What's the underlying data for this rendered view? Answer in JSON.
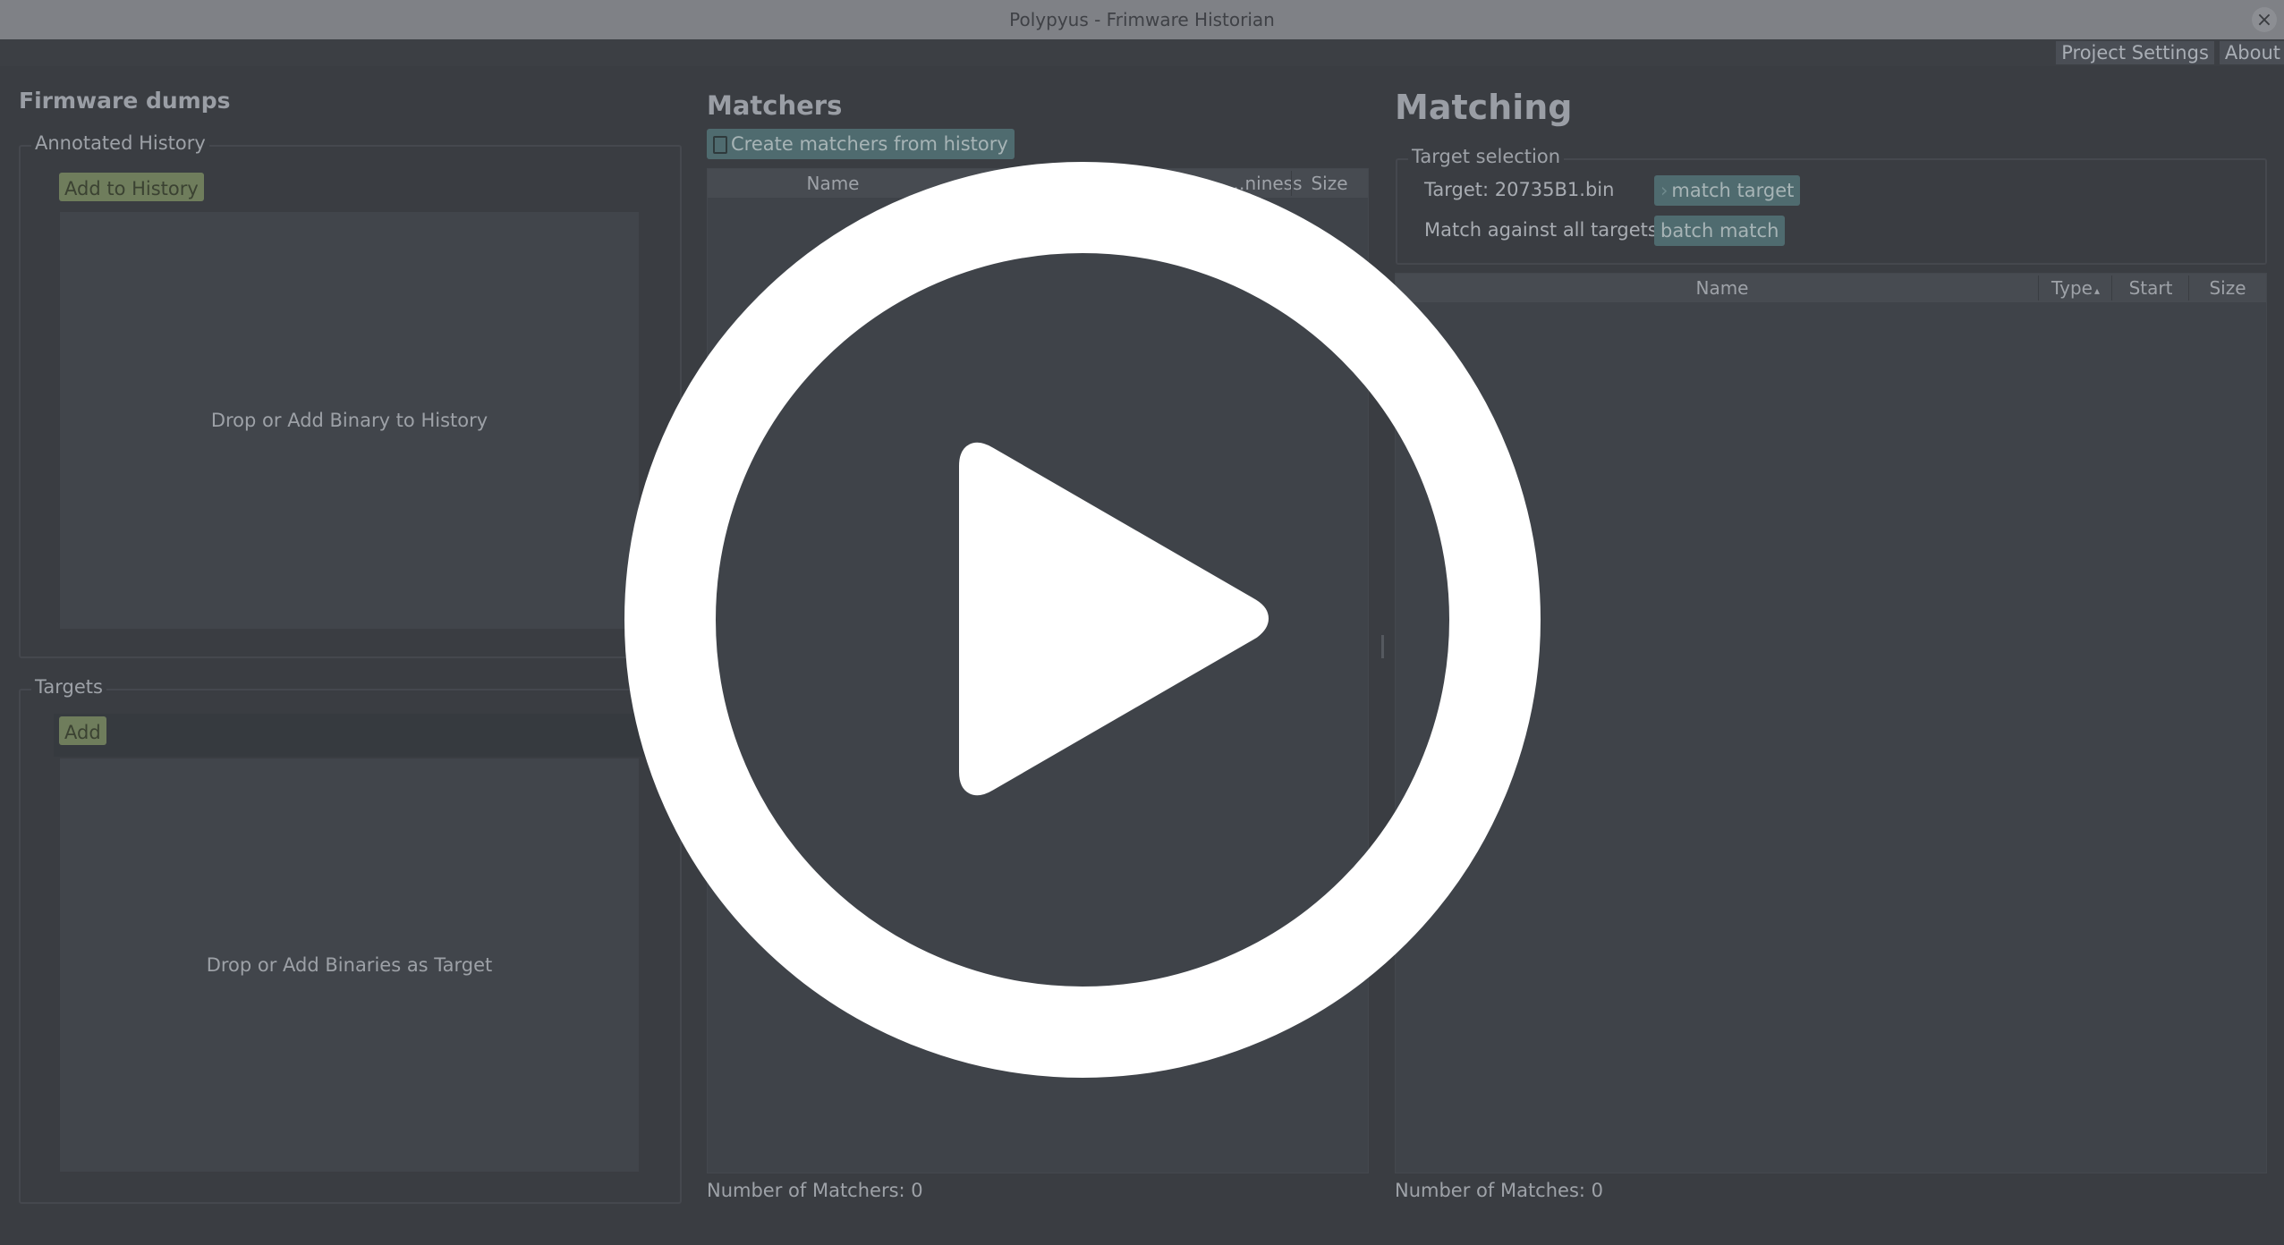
{
  "window": {
    "title": "Polypyus - Frimware Historian",
    "close_glyph": "×"
  },
  "menubar": {
    "project_settings": "Project Settings",
    "about": "About"
  },
  "firmware_dumps": {
    "heading": "Firmware dumps",
    "annotated_history": {
      "legend": "Annotated History",
      "add_button": "Add to History",
      "drop_hint": "Drop or Add Binary to History"
    },
    "targets": {
      "legend": "Targets",
      "add_button": "Add",
      "drop_hint": "Drop or Add Binaries as Target"
    }
  },
  "matchers": {
    "heading": "Matchers",
    "create_button": "Create matchers from history",
    "columns": [
      "Name",
      "",
      "…niness",
      "Size"
    ],
    "status": "Number of Matchers: 0"
  },
  "matching": {
    "heading": "Matching",
    "target_selection": {
      "legend": "Target selection",
      "target_label": "Target: 20735B1.bin",
      "match_target_button": "match target",
      "match_all_label": "Match against all targets",
      "batch_match_button": "batch match"
    },
    "columns": [
      "Name",
      "Type",
      "Start",
      "Size"
    ],
    "sort_indicator": "▴",
    "status": "Number of Matches: 0"
  },
  "overlay": {
    "icon": "play-icon",
    "color": "#ffffff"
  },
  "colors": {
    "background": "#3a3d42",
    "green_button": "#6f7d5c",
    "teal_button": "#4f6b6f"
  }
}
